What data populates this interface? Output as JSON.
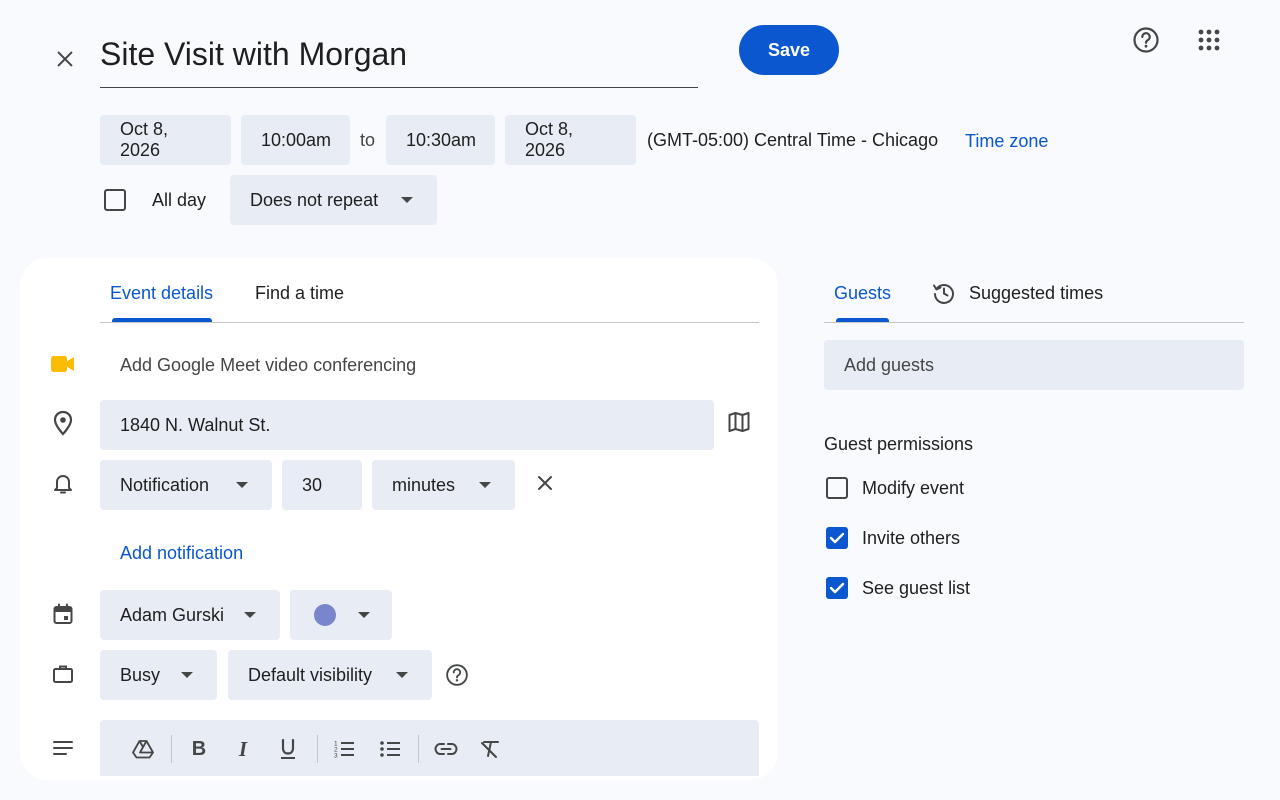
{
  "header": {
    "title": "Site Visit with Morgan",
    "save_label": "Save"
  },
  "datetime": {
    "start_date": "Oct 8, 2026",
    "start_time": "10:00am",
    "to_label": "to",
    "end_time": "10:30am",
    "end_date": "Oct 8, 2026",
    "timezone_text": "(GMT-05:00) Central Time - Chicago",
    "timezone_link": "Time zone",
    "all_day_label": "All day",
    "all_day_checked": false,
    "repeat_value": "Does not repeat"
  },
  "tabs": {
    "event_details": "Event details",
    "find_time": "Find a time",
    "active": "Event details"
  },
  "details": {
    "meet_label": "Add Google Meet video conferencing",
    "location_value": "1840 N. Walnut St.",
    "notification_type": "Notification",
    "notification_amount": "30",
    "notification_unit": "minutes",
    "add_notification": "Add notification",
    "calendar_owner": "Adam Gurski",
    "event_color": "#7986cb",
    "busy_value": "Busy",
    "visibility_value": "Default visibility"
  },
  "guests_panel": {
    "guests_tab": "Guests",
    "suggested_tab": "Suggested times",
    "add_guests_placeholder": "Add guests",
    "permissions_title": "Guest permissions",
    "permissions": [
      {
        "label": "Modify event",
        "checked": false
      },
      {
        "label": "Invite others",
        "checked": true
      },
      {
        "label": "See guest list",
        "checked": true
      }
    ]
  },
  "colors": {
    "accent": "#0b57d0",
    "chip_bg": "#e8edf5",
    "page_bg": "#f8fafd",
    "meet_icon": "#fbbc04"
  },
  "icons": {
    "close": "close-icon",
    "help": "help-icon",
    "apps": "apps-grid-icon",
    "meet": "google-meet-icon",
    "location": "location-pin-icon",
    "map": "map-icon",
    "bell": "bell-icon",
    "calendar": "calendar-icon",
    "briefcase": "briefcase-icon",
    "description": "description-icon",
    "history": "history-icon"
  }
}
